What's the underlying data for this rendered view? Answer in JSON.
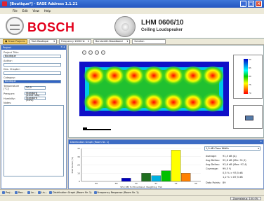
{
  "window": {
    "title": "[Boutique*] - EASE Address 1.1.21",
    "minimize": "_",
    "maximize": "□",
    "close": "×"
  },
  "menu": [
    "File",
    "Edit",
    "View",
    "Help"
  ],
  "banner": {
    "brand": "BOSCH",
    "model": "LHM 0606/10",
    "model_subtitle": "Ceiling Loudspeaker"
  },
  "toolbar": {
    "items": [
      {
        "label": "Show Projects",
        "active": true
      },
      {
        "label": "Task",
        "value": "Boutique"
      },
      {
        "label": "Frequency",
        "value": "1000 Hz"
      },
      {
        "label": "Bandwidth",
        "value": "Broadband"
      },
      {
        "label": "Solution",
        "value": ""
      }
    ]
  },
  "project_panel": {
    "header": "Project",
    "fields": [
      {
        "label": "Project Title:",
        "value": "Boutique"
      },
      {
        "label": "Author:",
        "value": ""
      },
      {
        "label": "Des. Chapter:",
        "value": ""
      },
      {
        "label": "Category:",
        "value": "Boutique",
        "selected": true
      }
    ],
    "temperature": {
      "label": "Temperature [°C]:",
      "value": "20,0"
    },
    "pressure": {
      "label": "Pressure:",
      "value": "Standard (1013 hPa)"
    },
    "humidity": {
      "label": "Humidity:",
      "value": "Standard (50%)"
    },
    "notes_label": "Notes:"
  },
  "legend": {
    "ticks": [
      "90",
      "85",
      "80",
      "75",
      "70"
    ]
  },
  "distribution": {
    "header": "Distribution Graph (Room Nr. 1)",
    "dropdown": "1,0 dB Class Width",
    "results": [
      {
        "label": "Average:",
        "value": "91,5 dB (A)"
      },
      {
        "label": "Avg Deltas:",
        "value": "92,6 dB (Min: 91,5)"
      },
      {
        "label": "Avg Deltas:",
        "value": "93,6 dB (Max: 97,4)"
      },
      {
        "label": "Coverage:",
        "value": "99,5 %"
      },
      {
        "label": "",
        "value": "0,5 % > 93,5 dB"
      },
      {
        "label": "",
        "value": "1,2 % < 87,5 dB"
      },
      {
        "label": "Data Points:",
        "value": "89"
      }
    ]
  },
  "chart_data": {
    "type": "bar",
    "categories": [
      "85",
      "86",
      "87",
      "88",
      "89",
      "90",
      "91",
      "92",
      "93",
      "94",
      "95",
      "96"
    ],
    "values": [
      0,
      0,
      0,
      0,
      4,
      0,
      10,
      7,
      13,
      38,
      10,
      0
    ],
    "colors": [
      "#0000c0",
      "#0000c0",
      "#0000c0",
      "#0000c0",
      "#0000c0",
      "#0000c0",
      "#207020",
      "#00b0e0",
      "#00c000",
      "#ffff00",
      "#ff8000",
      "#ff0000"
    ],
    "xlabel": "SPL [dB] for Broadband, Weighting: Flat",
    "ylabel": "Distribution [%]",
    "yticks": [
      "0",
      "10",
      "20",
      "30",
      "40"
    ],
    "ylim": [
      0,
      40
    ]
  },
  "taskbar": [
    "Proj...",
    "Roo...",
    "Lo...",
    "Lis...",
    "Distribution Graph (Room Nr. 1)",
    "Frequency Response (Room Nr. 1)"
  ],
  "status": {
    "zoom": "Zoomstatus: 100,0%"
  }
}
